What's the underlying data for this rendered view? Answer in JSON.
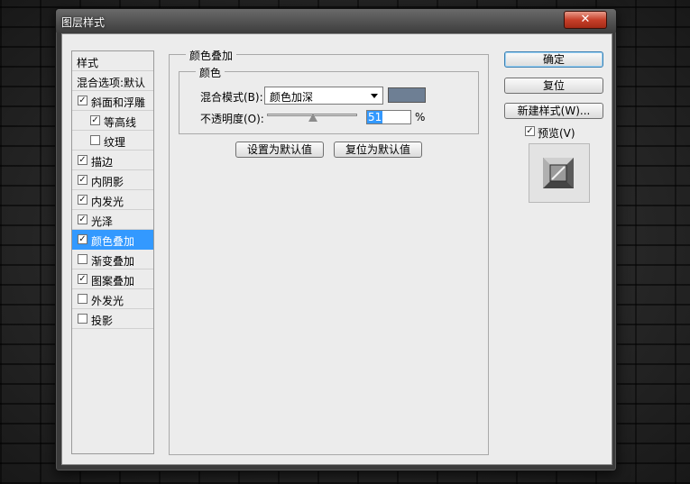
{
  "window": {
    "title": "图层样式",
    "close_glyph": "✕"
  },
  "styles_list": {
    "header": "样式",
    "blend_options": "混合选项:默认",
    "items": [
      {
        "label": "斜面和浮雕",
        "checked": true
      },
      {
        "label": "等高线",
        "checked": true
      },
      {
        "label": "纹理",
        "checked": false
      },
      {
        "label": "描边",
        "checked": true
      },
      {
        "label": "内阴影",
        "checked": true
      },
      {
        "label": "内发光",
        "checked": true
      },
      {
        "label": "光泽",
        "checked": true
      },
      {
        "label": "颜色叠加",
        "checked": true,
        "selected": true
      },
      {
        "label": "渐变叠加",
        "checked": false
      },
      {
        "label": "图案叠加",
        "checked": true
      },
      {
        "label": "外发光",
        "checked": false
      },
      {
        "label": "投影",
        "checked": false
      }
    ]
  },
  "color_overlay": {
    "section_title": "颜色叠加",
    "subsection_title": "颜色",
    "blend_mode_label": "混合模式(B):",
    "blend_mode_value": "颜色加深",
    "overlay_color": "#6e7f94",
    "opacity_label": "不透明度(O):",
    "opacity_value": "51",
    "opacity_unit": "%",
    "set_default_button": "设置为默认值",
    "reset_default_button": "复位为默认值"
  },
  "actions": {
    "ok": "确定",
    "reset": "复位",
    "new_style": "新建样式(W)...",
    "preview_label": "预览(V)",
    "preview_checked": true
  },
  "check_glyph": "✓"
}
